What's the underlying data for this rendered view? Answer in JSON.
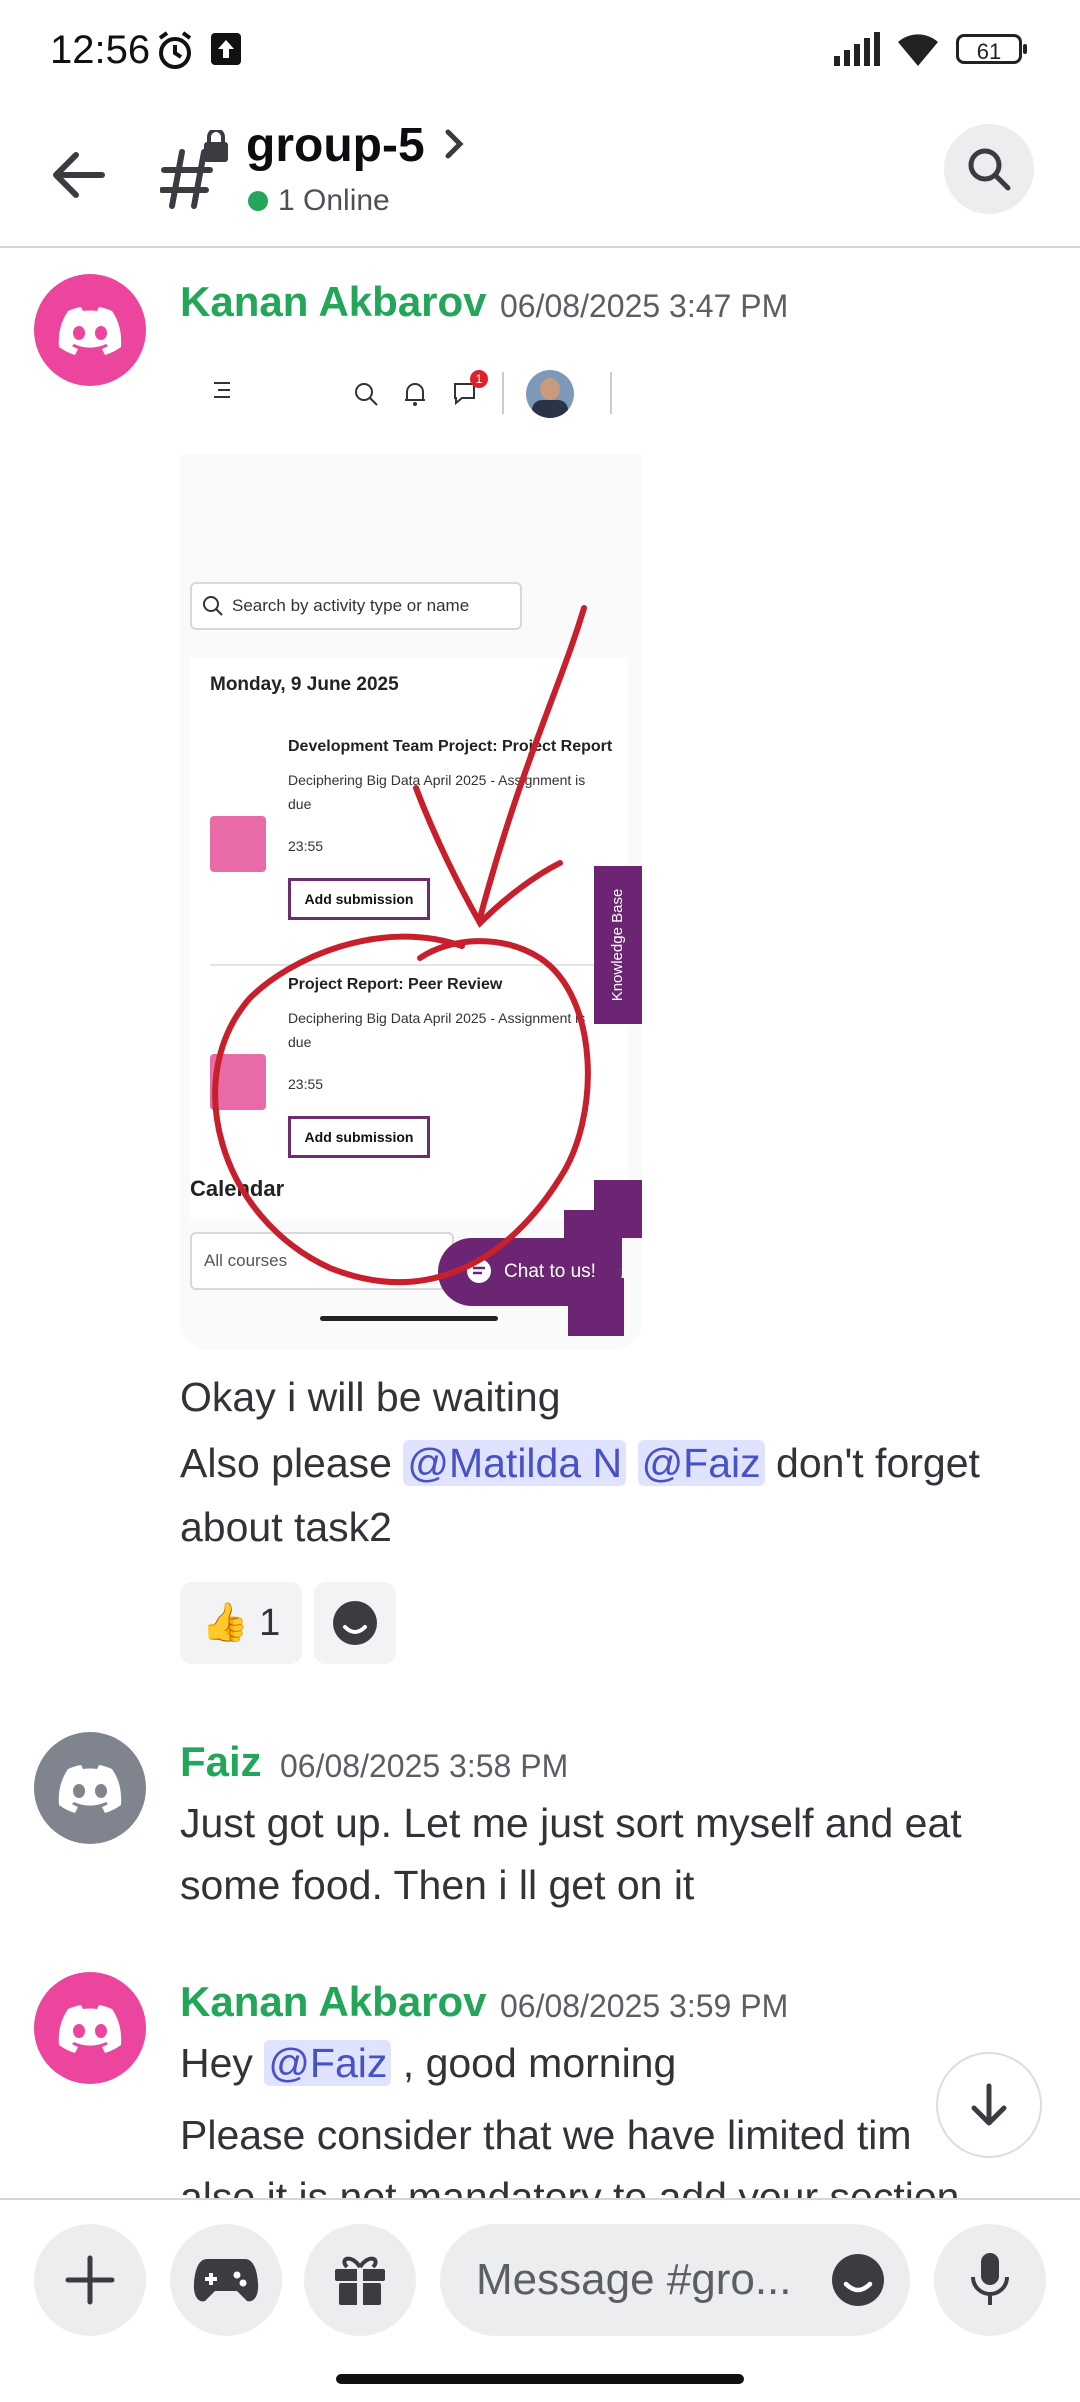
{
  "status_bar": {
    "time": "12:56",
    "battery": "61"
  },
  "header": {
    "channel_name": "group-5",
    "online_status": "1 Online"
  },
  "messages": [
    {
      "author": "Kanan Akbarov",
      "timestamp": "06/08/2025 3:47 PM",
      "attachment": {
        "search_placeholder": "Search by activity type or name",
        "date_heading": "Monday, 9 June 2025",
        "notification_count": "1",
        "tasks": [
          {
            "title": "Development Team Project: Project Report",
            "course": "Deciphering Big Data April 2025 - Assignment is due",
            "time": "23:55",
            "button": "Add submission"
          },
          {
            "title": "Project Report: Peer Review",
            "course": "Deciphering Big Data April 2025 - Assignment is due",
            "time": "23:55",
            "button": "Add submission"
          }
        ],
        "knowledge_base": "Knowledge Base",
        "calendar_heading": "Calendar",
        "courses_select": "All courses",
        "chat_button": "Chat to us!"
      },
      "lines": [
        "Okay i will be waiting"
      ],
      "line2_prefix": "Also please ",
      "mention1": "@Matilda N",
      "mention2": "@Faiz",
      "line2_suffix": " don't forget",
      "line3": "about task2",
      "reaction": {
        "emoji": "👍",
        "count": "1"
      }
    },
    {
      "author": "Faiz",
      "timestamp": "06/08/2025 3:58 PM",
      "line1": "Just got up. Let me just sort myself and eat",
      "line2": "some food. Then i ll get on it"
    },
    {
      "author": "Kanan Akbarov",
      "timestamp": "06/08/2025 3:59 PM",
      "prefix": "Hey ",
      "mention": "@Faiz",
      "suffix": " , good morning",
      "line2": "Please consider that we have limited tim",
      "line3": "also it is not mandatory to add your section"
    }
  ],
  "composer": {
    "placeholder": "Message #gro..."
  },
  "colors": {
    "author": "#23a55a",
    "discord_pink": "#eb459e",
    "discord_gray": "#80848e",
    "mention_bg": "#e0e3ff"
  }
}
